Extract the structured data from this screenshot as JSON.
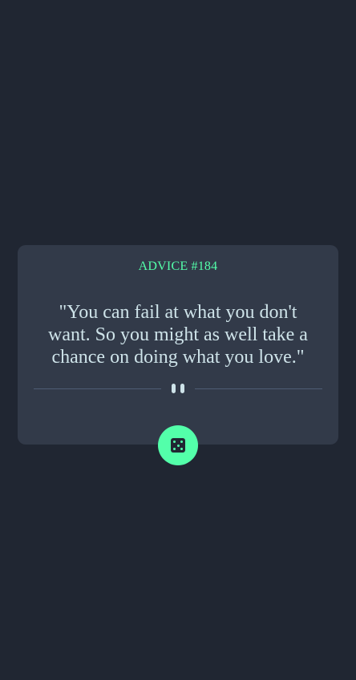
{
  "card": {
    "advice_label": "ADVICE #184",
    "quote": "\"You can fail at what you don't want. So you might as well take a chance on doing what you love.\""
  },
  "divider": {
    "icon": "pause-icon"
  },
  "button": {
    "icon": "dice-icon"
  },
  "colors": {
    "background": "#202632",
    "card": "#323a49",
    "accent": "#53ffaa",
    "text": "#cee3e9",
    "divider": "#4f5d74"
  }
}
